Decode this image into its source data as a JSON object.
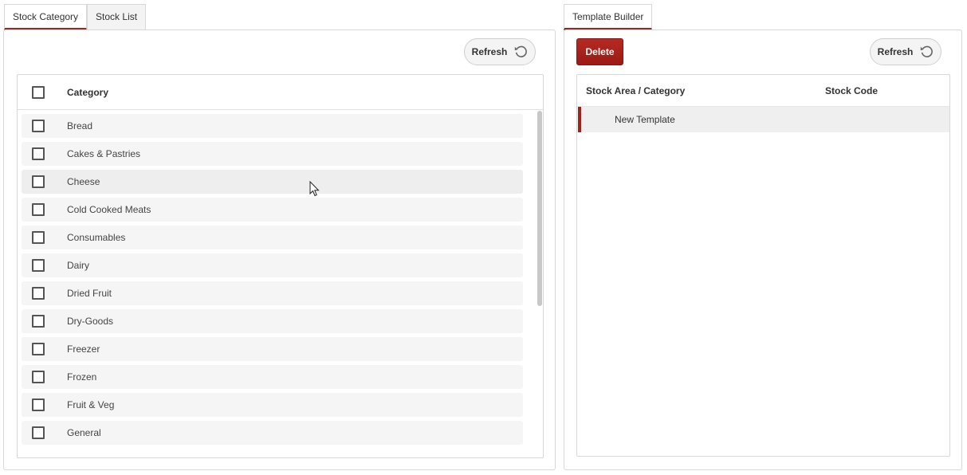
{
  "left": {
    "tabs": [
      {
        "label": "Stock Category"
      },
      {
        "label": "Stock List"
      }
    ],
    "refresh_label": "Refresh",
    "grid": {
      "header": "Category",
      "rows": [
        "Bread",
        "Cakes & Pastries",
        "Cheese",
        "Cold Cooked Meats",
        "Consumables",
        "Dairy",
        "Dried Fruit",
        "Dry-Goods",
        "Freezer",
        "Frozen",
        "Fruit & Veg",
        "General"
      ]
    }
  },
  "right": {
    "tabs": [
      {
        "label": "Template Builder"
      }
    ],
    "delete_label": "Delete",
    "refresh_label": "Refresh",
    "columns": [
      "Stock Area / Category",
      "Stock Code"
    ],
    "rows": [
      "New Template"
    ]
  },
  "icons": {
    "refresh": "refresh-icon",
    "cursor": "mouse-pointer-icon"
  },
  "colors": {
    "accent": "#a5201c",
    "row_bg": "#f5f5f5"
  }
}
